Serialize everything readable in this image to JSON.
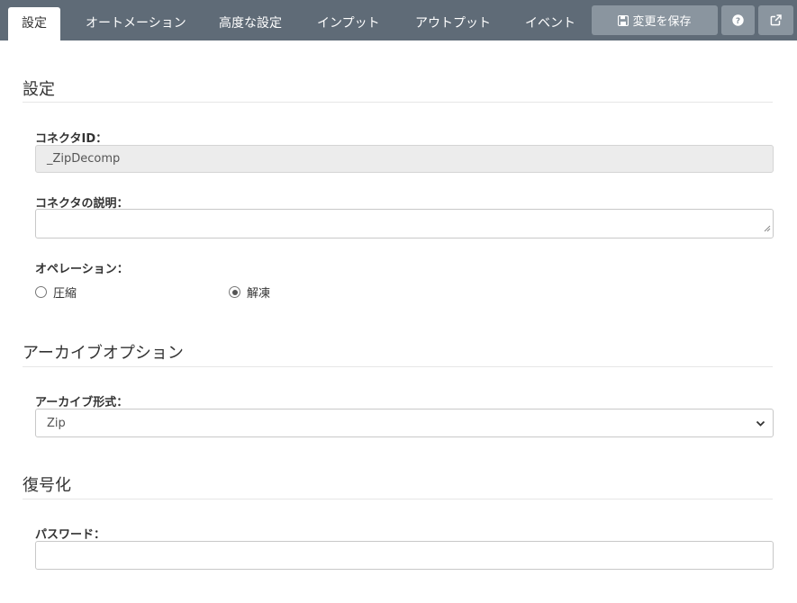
{
  "tabs": [
    {
      "label": "設定",
      "active": true
    },
    {
      "label": "オートメーション",
      "active": false
    },
    {
      "label": "高度な設定",
      "active": false
    },
    {
      "label": "インプット",
      "active": false
    },
    {
      "label": "アウトプット",
      "active": false
    },
    {
      "label": "イベント",
      "active": false
    }
  ],
  "toolbar": {
    "save_label": "変更を保存",
    "save_icon": "floppy-disk-icon",
    "help_icon": "question-circle-icon",
    "external_icon": "external-link-icon"
  },
  "sections": {
    "settings": {
      "title": "設定",
      "connector_id_label": "コネクタID：",
      "connector_id_value": "_ZipDecomp",
      "description_label": "コネクタの説明：",
      "description_value": "",
      "operation_label": "オペレーション：",
      "operation_options": [
        {
          "label": "圧縮",
          "checked": false
        },
        {
          "label": "解凍",
          "checked": true
        }
      ]
    },
    "archive": {
      "title": "アーカイブオプション",
      "format_label": "アーカイブ形式：",
      "format_value": "Zip"
    },
    "decryption": {
      "title": "復号化",
      "password_label": "パスワード：",
      "password_value": ""
    }
  },
  "colors": {
    "topbar": "#5f6b77",
    "toolbar_button": "#8a959f",
    "readonly_input": "#ececec"
  }
}
